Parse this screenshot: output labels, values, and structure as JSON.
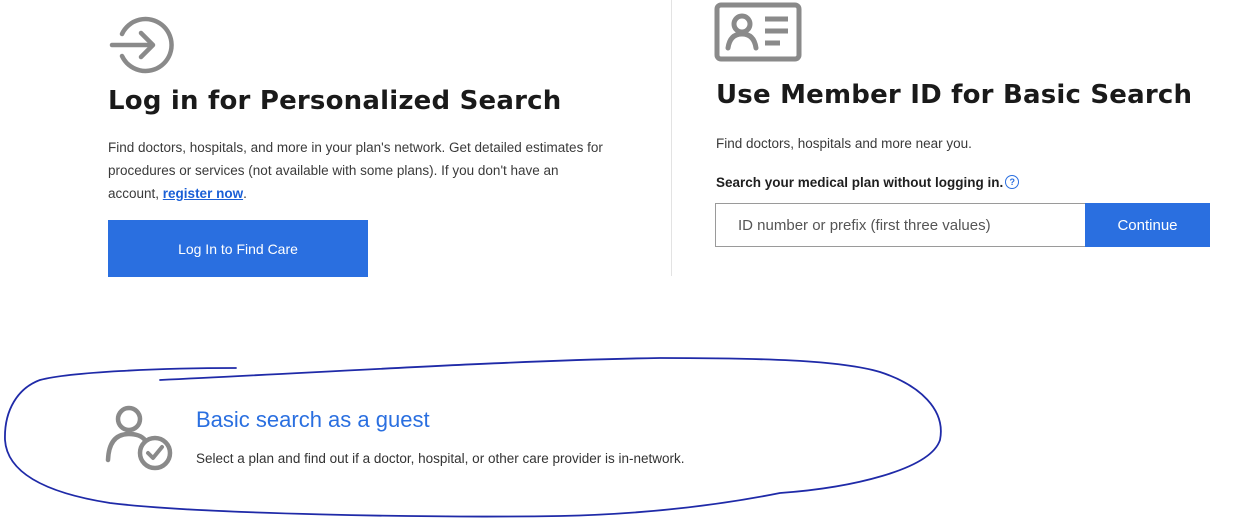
{
  "login_card": {
    "icon": "login-arrow-icon",
    "title": "Log in for Personalized Search",
    "description": "Find doctors, hospitals, and more in your plan's network. Get detailed estimates for procedures or services (not available with some plans). If you don't have an account, ",
    "register_link": "register now",
    "description_end": ".",
    "button_label": "Log In to Find Care"
  },
  "member_card": {
    "icon": "id-card-icon",
    "title": "Use Member ID for Basic Search",
    "description": "Find doctors, hospitals and more near you.",
    "search_label": "Search your medical plan without logging in.",
    "help_icon": "question-circle-icon",
    "input_placeholder": "ID number or prefix (first three values)",
    "input_value": "",
    "button_label": "Continue"
  },
  "guest": {
    "icon": "user-check-icon",
    "title": "Basic search as a guest",
    "description": "Select a plan and find out if a doctor, hospital, or other care provider is in-network.",
    "annotation": "hand-drawn-circle"
  },
  "colors": {
    "primary": "#2a6fe0",
    "link": "#1a5fd6",
    "icon_gray": "#8a8a8a",
    "annotation": "#1f2aa8"
  }
}
